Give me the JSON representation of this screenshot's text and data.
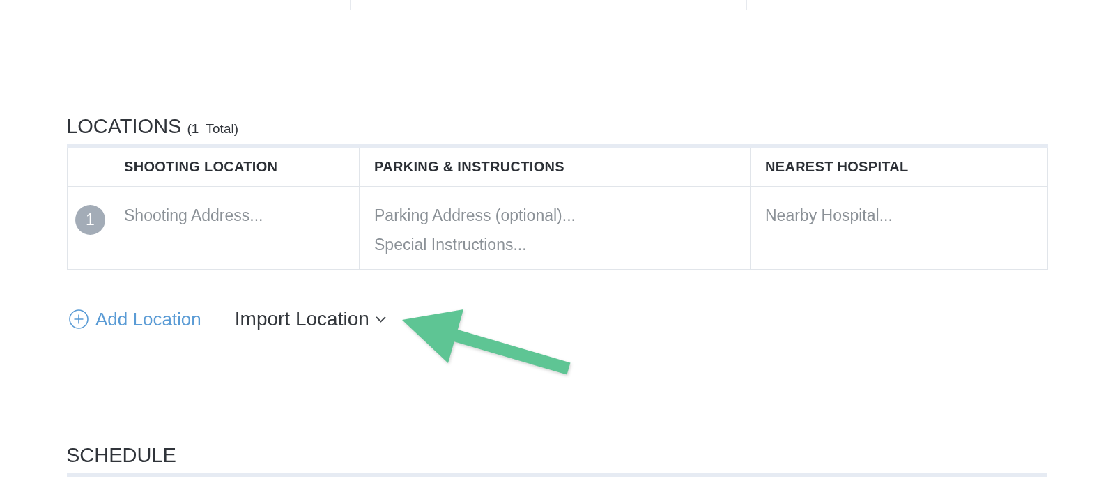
{
  "locations": {
    "title": "LOCATIONS",
    "total": "(1  Total)",
    "columns": [
      "SHOOTING LOCATION",
      "PARKING & INSTRUCTIONS",
      "NEAREST HOSPITAL"
    ],
    "rows": [
      {
        "number": "1",
        "shooting_address": {
          "placeholder": "Shooting Address..."
        },
        "parking_address": {
          "placeholder": "Parking Address (optional)..."
        },
        "special_instructions": {
          "placeholder": "Special Instructions..."
        },
        "nearest_hospital": {
          "placeholder": "Nearby Hospital..."
        }
      }
    ],
    "actions": {
      "add": "Add Location",
      "import": "Import Location"
    }
  },
  "schedule": {
    "title": "SCHEDULE"
  }
}
